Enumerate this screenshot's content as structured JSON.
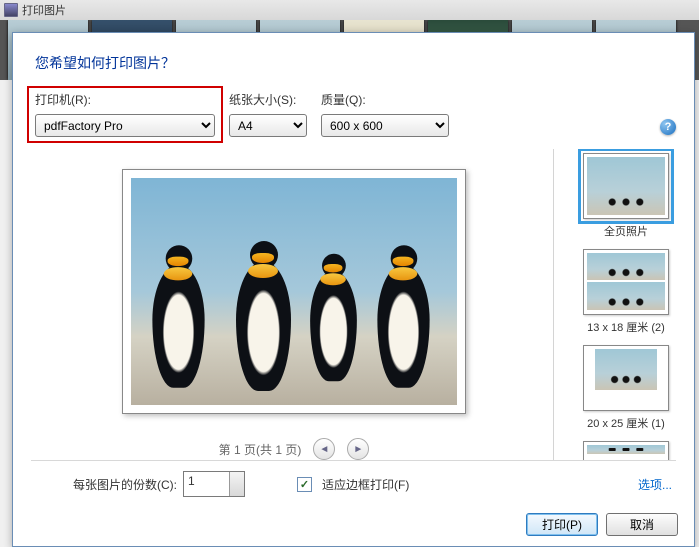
{
  "window": {
    "title": "打印图片"
  },
  "header": {
    "question": "您希望如何打印图片？"
  },
  "controls": {
    "printer": {
      "label": "打印机(R):",
      "value": "pdfFactory Pro"
    },
    "paper": {
      "label": "纸张大小(S):",
      "value": "A4"
    },
    "quality": {
      "label": "质量(Q):",
      "value": "600 x 600"
    }
  },
  "pager": {
    "text": "第 1 页(共 1 页)"
  },
  "layouts": [
    {
      "label": "全页照片",
      "type": "full",
      "selected": true
    },
    {
      "label": "13 x 18 厘米 (2)",
      "type": "two",
      "selected": false
    },
    {
      "label": "20 x 25 厘米 (1)",
      "type": "one-med",
      "selected": false
    }
  ],
  "bottom": {
    "copies_label": "每张图片的份数(C):",
    "copies_value": "1",
    "fit_frame": "适应边框打印(F)",
    "fit_checked": true,
    "options": "选项..."
  },
  "buttons": {
    "print": "打印(P)",
    "cancel": "取消"
  }
}
